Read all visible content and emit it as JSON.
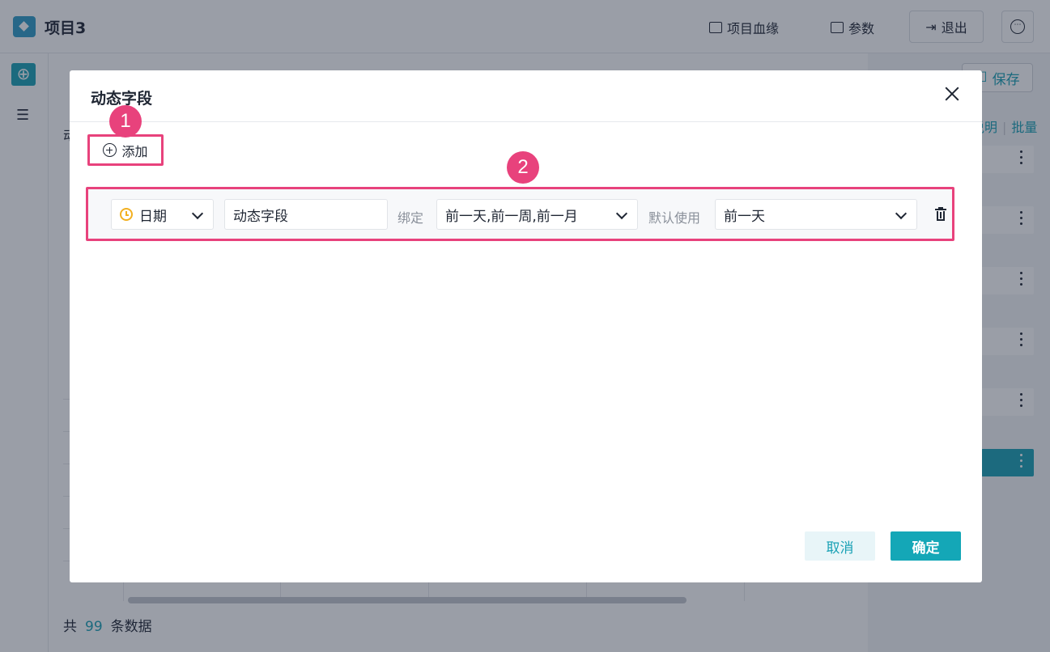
{
  "app": {
    "title": "项目3",
    "lineage_label": "项目血缘",
    "params_label": "参数",
    "exit_label": "退出",
    "more_icon": "ellipsis-circle-icon"
  },
  "right_panel": {
    "save_label": "保存",
    "link_explain": "说明",
    "link_batch": "批量"
  },
  "background": {
    "field_label_fragment": "动",
    "footer_prefix": "共",
    "footer_count": "99",
    "footer_suffix": "条数据"
  },
  "dialog": {
    "title": "动态字段",
    "add_label": "添加",
    "badge_1": "1",
    "badge_2": "2",
    "row": {
      "type_value": "日期",
      "name_value": "动态字段",
      "bind_label": "绑定",
      "bind_value": "前一天,前一周,前一月",
      "default_label": "默认使用",
      "default_value": "前一天"
    },
    "cancel_label": "取消",
    "ok_label": "确定"
  },
  "colors": {
    "accent": "#14a7b7",
    "highlight": "#e8427c",
    "date_icon": "#f2b021"
  }
}
